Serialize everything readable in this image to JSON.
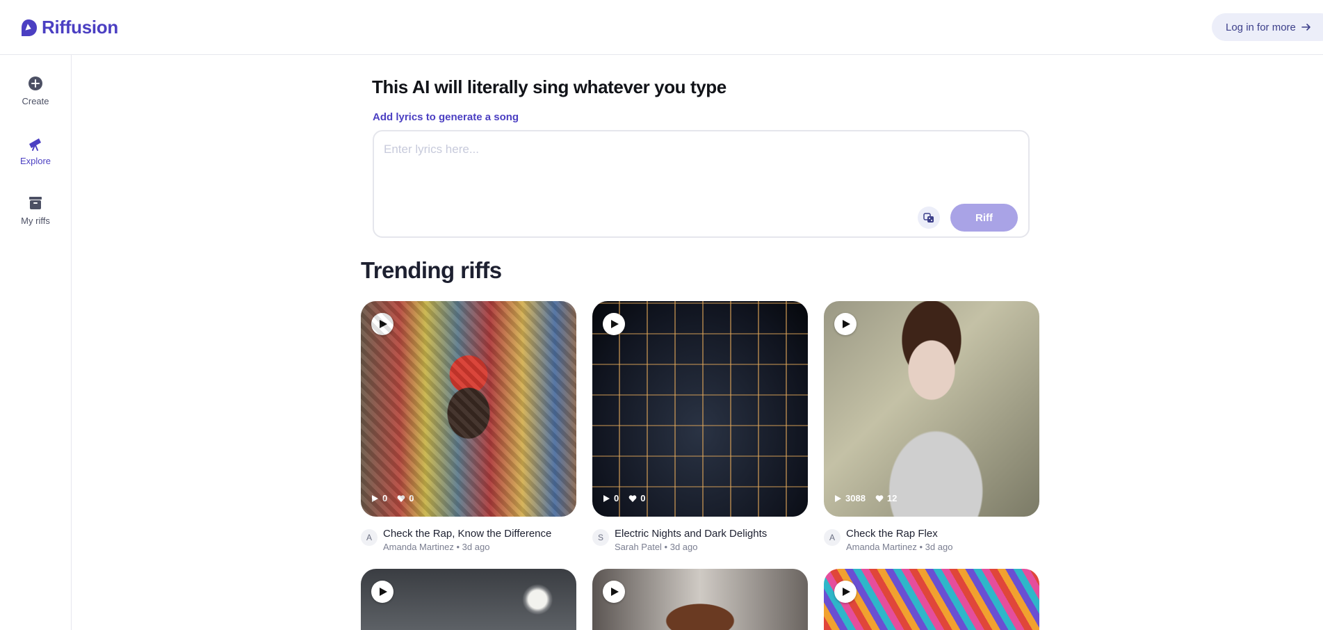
{
  "app": {
    "name": "Riffusion",
    "brand_color": "#4b3fc2"
  },
  "header": {
    "login_label": "Log in for more"
  },
  "sidebar": {
    "items": [
      {
        "label": "Create",
        "icon": "plus-circle-icon"
      },
      {
        "label": "Explore",
        "icon": "telescope-icon"
      },
      {
        "label": "My riffs",
        "icon": "archive-box-icon"
      }
    ],
    "active": "Explore"
  },
  "composer": {
    "title": "This AI will literally sing whatever you type",
    "subtitle": "Add lyrics to generate a song",
    "placeholder": "Enter lyrics here...",
    "value": "",
    "dice_icon": "dice-icon",
    "submit_label": "Riff"
  },
  "trending": {
    "title": "Trending riffs",
    "cards": [
      {
        "title": "Check the Rap, Know the Difference",
        "author": "Amanda Martinez",
        "initial": "A",
        "age": "3d ago",
        "plays": "0",
        "likes": "0"
      },
      {
        "title": "Electric Nights and Dark Delights",
        "author": "Sarah Patel",
        "initial": "S",
        "age": "3d ago",
        "plays": "0",
        "likes": "0"
      },
      {
        "title": "Check the Rap Flex",
        "author": "Amanda Martinez",
        "initial": "A",
        "age": "3d ago",
        "plays": "3088",
        "likes": "12"
      },
      {
        "title": "",
        "author": "",
        "initial": "",
        "age": "",
        "plays": "",
        "likes": ""
      },
      {
        "title": "",
        "author": "",
        "initial": "",
        "age": "",
        "plays": "",
        "likes": ""
      },
      {
        "title": "",
        "author": "",
        "initial": "",
        "age": "",
        "plays": "",
        "likes": ""
      }
    ]
  }
}
